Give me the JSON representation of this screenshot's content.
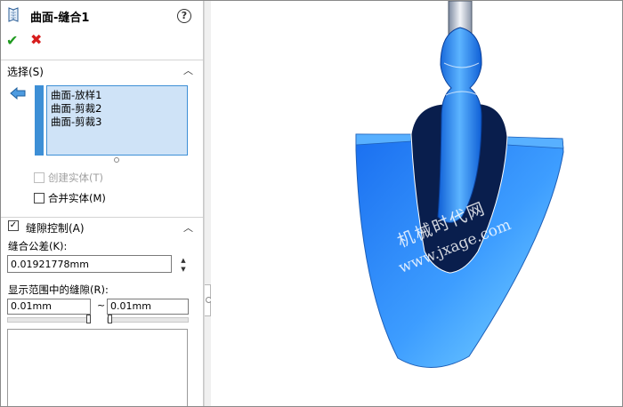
{
  "panel": {
    "title": "曲面-缝合1",
    "help_icon": "help-icon",
    "confirm_icon": "checkmark-icon",
    "cancel_icon": "x-icon"
  },
  "selection": {
    "header": "选择(S)",
    "items": [
      "曲面-放样1",
      "曲面-剪裁2",
      "曲面-剪裁3"
    ],
    "create_solid": {
      "label": "创建实体(T)",
      "checked": false,
      "enabled": false
    },
    "merge_entities": {
      "label": "合并实体(M)",
      "checked": false,
      "enabled": true
    }
  },
  "gap_control": {
    "header": "缝隙控制(A)",
    "checked": true,
    "tolerance_label": "缝合公差(K):",
    "tolerance_value": "0.01921778mm",
    "range_label": "显示范围中的缝隙(R):",
    "range_min": "0.01mm",
    "range_separator": "~",
    "range_max": "0.01mm"
  },
  "viewport": {
    "model": "shovel-surface-model",
    "watermark_cn": "机械时代网",
    "watermark_en": "www.jxage.com"
  },
  "colors": {
    "accent": "#3d8fd6",
    "selection_bg": "#cfe3f7",
    "ok": "#1f9a1f",
    "cancel": "#d71d1d",
    "surface": "#2f86ff",
    "surface_dark": "#0a2a66"
  }
}
